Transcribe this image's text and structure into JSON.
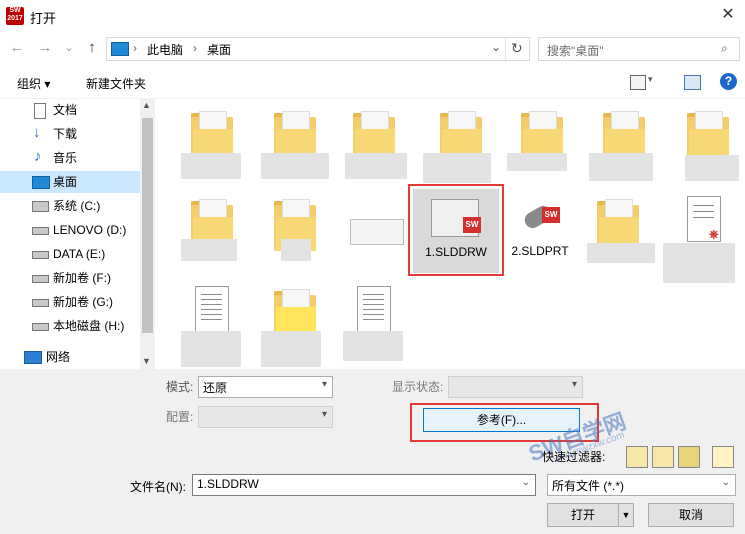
{
  "window": {
    "title": "打开",
    "app_icon_text": "SW 2017"
  },
  "nav": {
    "back": "←",
    "forward": "→",
    "dropdown": "⌄",
    "up": "↑"
  },
  "address": {
    "path": [
      "此电脑",
      "桌面"
    ],
    "refresh": "↻"
  },
  "search": {
    "placeholder": "搜索\"桌面\""
  },
  "toolbar": {
    "organize": "组织 ▾",
    "new_folder": "新建文件夹"
  },
  "sidebar": {
    "items": [
      {
        "label": "文档",
        "icon": "document-icon"
      },
      {
        "label": "下载",
        "icon": "download-icon"
      },
      {
        "label": "音乐",
        "icon": "music-icon"
      },
      {
        "label": "桌面",
        "icon": "desktop-icon",
        "selected": true
      },
      {
        "label": "系统 (C:)",
        "icon": "system-drive-icon"
      },
      {
        "label": "LENOVO (D:)",
        "icon": "drive-icon"
      },
      {
        "label": "DATA (E:)",
        "icon": "drive-icon"
      },
      {
        "label": "新加卷 (F:)",
        "icon": "drive-icon"
      },
      {
        "label": "新加卷 (G:)",
        "icon": "drive-icon"
      },
      {
        "label": "本地磁盘 (H:)",
        "icon": "drive-icon"
      },
      {
        "label": "网络",
        "icon": "network-icon"
      }
    ]
  },
  "files": {
    "drawing": {
      "name": "1.SLDDRW",
      "badge": "SW"
    },
    "part": {
      "name": "2.SLDPRT",
      "badge": "SW"
    }
  },
  "options": {
    "mode_label": "模式:",
    "mode_value": "还原",
    "config_label": "配置:",
    "display_state_label": "显示状态:",
    "reference_button": "参考(F)...",
    "quick_filter_label": "快速过滤器:"
  },
  "filename": {
    "label": "文件名(N):",
    "value": "1.SLDDRW"
  },
  "filetype": {
    "value": "所有文件 (*.*)"
  },
  "buttons": {
    "open": "打开",
    "cancel": "取消"
  },
  "watermark": {
    "line1": "SW自学网",
    "line2": "www.swzxw.com"
  },
  "colors": {
    "highlight_border": "#e53935",
    "selected_nav": "#cce8ff",
    "accent": "#0063b1"
  }
}
